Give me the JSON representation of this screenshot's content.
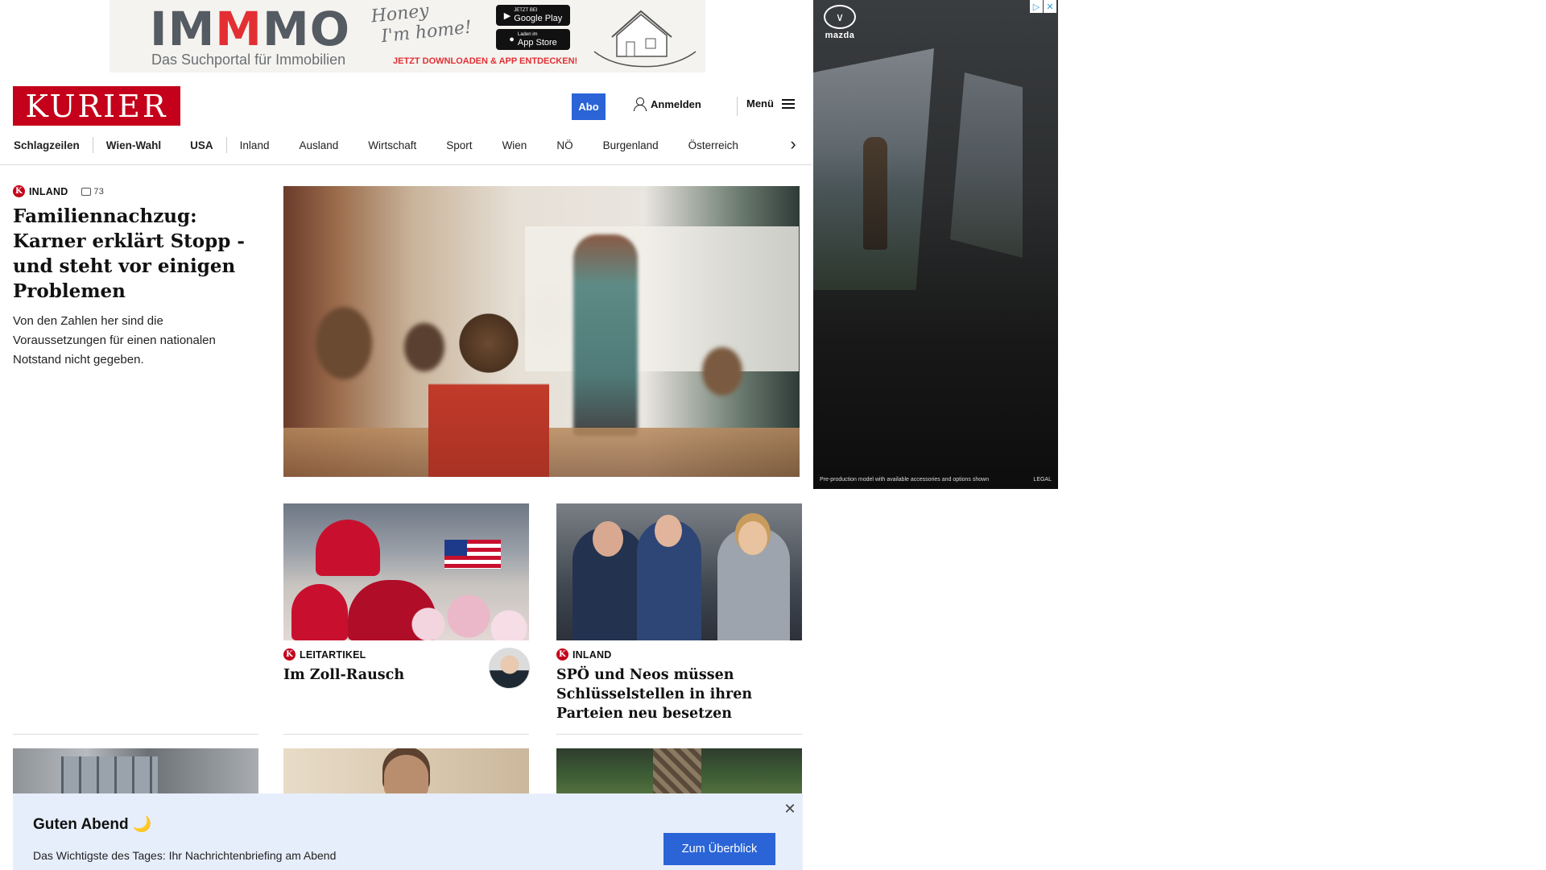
{
  "ads": {
    "top": {
      "brand_prefix": "IM",
      "brand_red": "M",
      "brand_suffix": "MO",
      "tagline_line1": "Honey",
      "tagline_line2": "I'm home!",
      "subtitle": "Das Suchportal für Immobilien",
      "cta": "JETZT DOWNLOADEN & APP ENTDECKEN!",
      "google_play_small": "JETZT BEI",
      "google_play": "Google Play",
      "app_store_small": "Laden im",
      "app_store": "App Store"
    },
    "right": {
      "brand": "mazda",
      "disclaimer": "Pre-production model with available accessories and options shown",
      "legal": "LEGAL",
      "adchoices_icon": "ad-choices-icon",
      "close_icon": "close-icon"
    }
  },
  "header": {
    "logo": "KURIER",
    "abo_label": "Abo",
    "login_label": "Anmelden",
    "menu_label": "Menü"
  },
  "nav": {
    "items": [
      "Schlagzeilen",
      "Wien-Wahl",
      "USA",
      "Inland",
      "Ausland",
      "Wirtschaft",
      "Sport",
      "Wien",
      "NÖ",
      "Burgenland",
      "Österreich"
    ]
  },
  "lead": {
    "kicker": "INLAND",
    "comment_count": "73",
    "headline": "Familiennachzug: Karner erklärt Stopp - und steht vor einigen Problemen",
    "teaser": "Von den Zahlen her sind die Voraussetzungen für einen nationalen Notstand nicht gegeben."
  },
  "cards": [
    {
      "kicker": "LEITARTIKEL",
      "headline": "Im Zoll-Rausch"
    },
    {
      "kicker": "INLAND",
      "headline": "SPÖ und Neos müssen Schlüsselstellen in ihren Parteien neu besetzen"
    }
  ],
  "briefing": {
    "title": "Guten Abend 🌙",
    "text": "Das Wichtigste des Tages: Ihr Nachrichtenbriefing am Abend",
    "button": "Zum Überblick",
    "close": "✕"
  },
  "colors": {
    "brand_red": "#c4001a",
    "accent_blue": "#2a64d6",
    "briefing_bg": "#e7eefb"
  }
}
